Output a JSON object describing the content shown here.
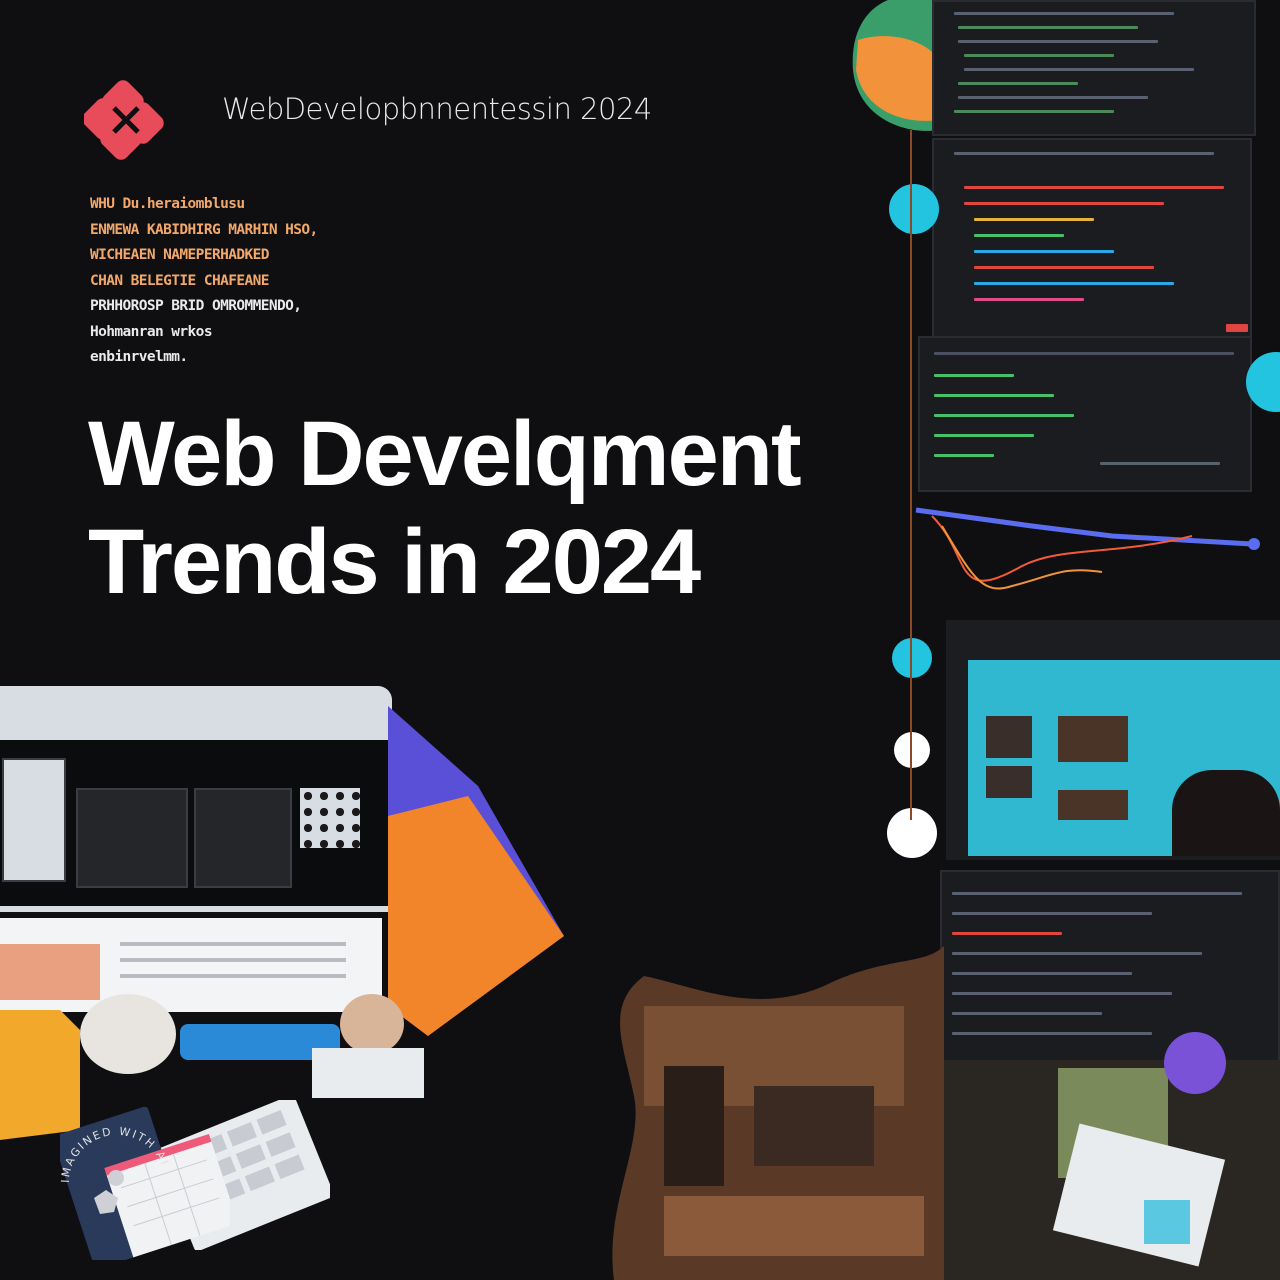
{
  "header": {
    "brand_text": "WebDevelopbnnentessin 2024",
    "logo_icon": "red-diamond-logo-icon"
  },
  "blurb": {
    "lines": [
      "WHU Du.heraiomblusu",
      "ENMEWA KABIDHIRG MARHIN HSO,",
      "WICHEAEN NAMEPERHADKED",
      "CHAN BELEGTIE CHAFEANE",
      "PRHHOROSP BRID OMROMMENDO,",
      "Hohmanran wrkos",
      "enbinrvelmm."
    ]
  },
  "headline": {
    "line1": "Web Develqment",
    "line2": "Trends in 2024"
  },
  "watermark": {
    "text": "IMAGINED WITH AI"
  },
  "colors": {
    "background": "#0f0f11",
    "accent_orange": "#f2a86a",
    "accent_cyan": "#22c4e0",
    "logo_red": "#e84b5a"
  }
}
